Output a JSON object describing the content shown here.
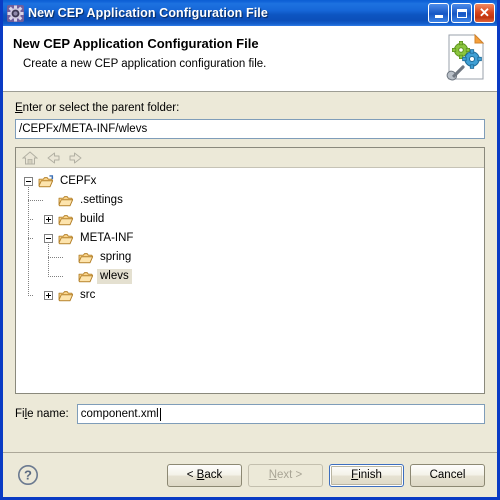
{
  "window": {
    "title": "New CEP Application Configuration File",
    "title_icon": "gear-icon",
    "controls": {
      "minimize": "minimize-icon",
      "maximize": "maximize-icon",
      "close": "close-icon",
      "close_glyph": "✕"
    },
    "colors": {
      "titlebar_blue": "#1667d8",
      "window_border": "#0a3bc4",
      "body_beige": "#ece9d8",
      "close_red": "#d6441c",
      "default_button_blue": "#3c6ebf",
      "selection_bg": "#e4e0d0"
    }
  },
  "header": {
    "title": "New CEP Application Configuration File",
    "subtitle": "Create a new CEP application configuration file.",
    "icon": "document-gears-wrench-icon"
  },
  "parent_folder": {
    "label_prefix": "",
    "label_mnemonic": "E",
    "label_suffix": "nter or select the parent folder:",
    "value": "/CEPFx/META-INF/wlevs"
  },
  "tree_toolbar": {
    "items": [
      {
        "name": "home-icon",
        "enabled": false
      },
      {
        "name": "back-arrow-icon",
        "enabled": false
      },
      {
        "name": "forward-arrow-icon",
        "enabled": false
      }
    ]
  },
  "tree": {
    "nodes": [
      {
        "label": "CEPFx",
        "depth": 0,
        "state": "expanded",
        "icon": "open-folder-project-icon",
        "selected": false
      },
      {
        "label": ".settings",
        "depth": 1,
        "state": "leaf",
        "icon": "open-folder-icon",
        "selected": false
      },
      {
        "label": "build",
        "depth": 1,
        "state": "collapsed",
        "icon": "open-folder-icon",
        "selected": false
      },
      {
        "label": "META-INF",
        "depth": 1,
        "state": "expanded",
        "icon": "open-folder-icon",
        "selected": false
      },
      {
        "label": "spring",
        "depth": 2,
        "state": "leaf",
        "icon": "open-folder-icon",
        "selected": false
      },
      {
        "label": "wlevs",
        "depth": 2,
        "state": "leaf",
        "icon": "open-folder-icon",
        "selected": true
      },
      {
        "label": "src",
        "depth": 1,
        "state": "collapsed",
        "icon": "open-folder-icon",
        "selected": false
      }
    ]
  },
  "file_name": {
    "label_prefix": "Fi",
    "label_mnemonic": "l",
    "label_suffix": "e name:",
    "value": "component.xml"
  },
  "footer": {
    "help_icon": "help-question-icon",
    "buttons": [
      {
        "name": "back-button",
        "label": "< Back",
        "mnemonic": "B",
        "enabled": true,
        "default": false
      },
      {
        "name": "next-button",
        "label": "Next >",
        "mnemonic": "N",
        "enabled": false,
        "default": false
      },
      {
        "name": "finish-button",
        "label": "Finish",
        "mnemonic": "F",
        "enabled": true,
        "default": true
      },
      {
        "name": "cancel-button",
        "label": "Cancel",
        "mnemonic": "",
        "enabled": true,
        "default": false
      }
    ]
  }
}
